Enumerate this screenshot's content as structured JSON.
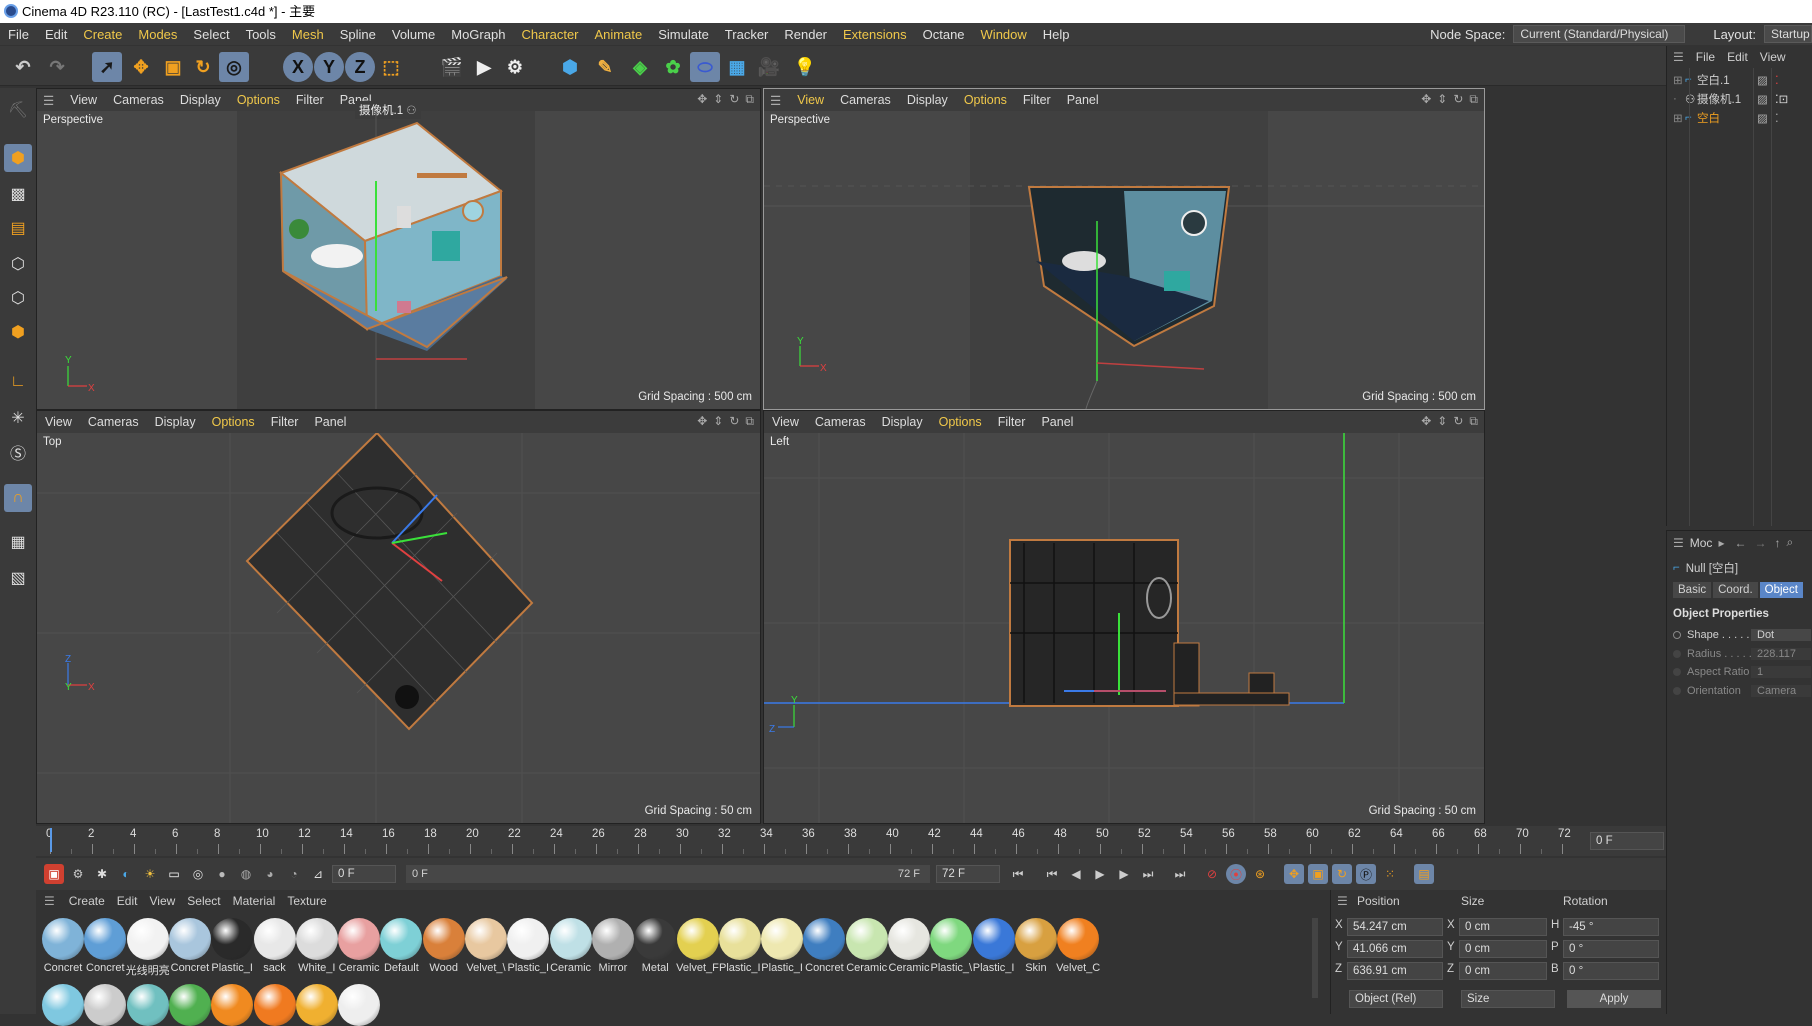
{
  "window": {
    "title": "Cinema 4D R23.110 (RC) - [LastTest1.c4d *] - 主要"
  },
  "menubar": {
    "items": [
      "File",
      "Edit",
      "Create",
      "Modes",
      "Select",
      "Tools",
      "Mesh",
      "Spline",
      "Volume",
      "MoGraph",
      "Character",
      "Animate",
      "Simulate",
      "Tracker",
      "Render",
      "Extensions",
      "Octane",
      "Window",
      "Help"
    ],
    "node_space_label": "Node Space:",
    "node_space_value": "Current (Standard/Physical)",
    "layout_label": "Layout:",
    "layout_value": "Startup ("
  },
  "toolbar": {
    "x_label": "X",
    "y_label": "Y",
    "z_label": "Z"
  },
  "viewports": [
    {
      "menu": [
        "View",
        "Cameras",
        "Display",
        "Options",
        "Filter",
        "Panel"
      ],
      "label": "Perspective",
      "camera_name": "摄像机.1",
      "grid_spacing": "Grid Spacing : 500 cm"
    },
    {
      "menu": [
        "View",
        "Cameras",
        "Display",
        "Options",
        "Filter",
        "Panel"
      ],
      "label": "Perspective",
      "grid_spacing": "Grid Spacing : 500 cm"
    },
    {
      "menu": [
        "View",
        "Cameras",
        "Display",
        "Options",
        "Filter",
        "Panel"
      ],
      "label": "Top",
      "grid_spacing": "Grid Spacing : 50 cm"
    },
    {
      "menu": [
        "View",
        "Cameras",
        "Display",
        "Options",
        "Filter",
        "Panel"
      ],
      "label": "Left",
      "grid_spacing": "Grid Spacing : 50 cm"
    }
  ],
  "object_manager": {
    "menu": [
      "File",
      "Edit",
      "View"
    ],
    "objects": [
      {
        "name": "空白.1",
        "selected": false
      },
      {
        "name": "摄像机.1",
        "selected": false
      },
      {
        "name": "空白",
        "selected": true
      }
    ]
  },
  "attribute_manager": {
    "mode_label": "Moc",
    "object_title": "Null [空白]",
    "tabs": [
      "Basic",
      "Coord.",
      "Object"
    ],
    "active_tab": "Object",
    "section_title": "Object Properties",
    "properties": [
      {
        "label": "Shape . . . . .",
        "value": "Dot"
      },
      {
        "label": "Radius . . . . .",
        "value": "228.117"
      },
      {
        "label": "Aspect Ratio",
        "value": "1"
      },
      {
        "label": "Orientation",
        "value": "Camera"
      }
    ]
  },
  "timeline": {
    "ticks": [
      "0",
      "2",
      "4",
      "6",
      "8",
      "10",
      "12",
      "14",
      "16",
      "18",
      "20",
      "22",
      "24",
      "26",
      "28",
      "30",
      "32",
      "34",
      "36",
      "38",
      "40",
      "42",
      "44",
      "46",
      "48",
      "50",
      "52",
      "54",
      "56",
      "58",
      "60",
      "62",
      "64",
      "66",
      "68",
      "70",
      "72"
    ],
    "current_frame": "0 F"
  },
  "playbar": {
    "start": "0 F",
    "range_start": "0 F",
    "range_end": "72 F",
    "end": "72 F"
  },
  "material_manager": {
    "menu": [
      "Create",
      "Edit",
      "View",
      "Select",
      "Material",
      "Texture"
    ],
    "materials": [
      {
        "name": "Concret",
        "color": "#7fb3d8"
      },
      {
        "name": "Concret",
        "color": "#5f9ed6"
      },
      {
        "name": "光线明亮",
        "color": "#f2f2f2"
      },
      {
        "name": "Concret",
        "color": "#a9c6dd"
      },
      {
        "name": "Plastic_I",
        "color": "#2a2a2a"
      },
      {
        "name": "sack",
        "color": "#e8e8e8"
      },
      {
        "name": "White_I",
        "color": "#dcdcdc"
      },
      {
        "name": "Ceramic",
        "color": "#e8a0a0"
      },
      {
        "name": "Default",
        "color": "#7ed0d6"
      },
      {
        "name": "Wood",
        "color": "#d9803a"
      },
      {
        "name": "Velvet_\\",
        "color": "#e8c8a0"
      },
      {
        "name": "Plastic_I",
        "color": "#f0f0f0"
      },
      {
        "name": "Ceramic",
        "color": "#bfe0e6"
      },
      {
        "name": "Mirror",
        "color": "#b0b0b0"
      },
      {
        "name": "Metal",
        "color": "#3a3a3a"
      },
      {
        "name": "Velvet_F",
        "color": "#e3d050"
      },
      {
        "name": "Plastic_I",
        "color": "#e8e09a"
      },
      {
        "name": "Plastic_I",
        "color": "#eee8b0"
      },
      {
        "name": "Concret",
        "color": "#3f7ec0"
      },
      {
        "name": "Ceramic",
        "color": "#c8e6b0"
      },
      {
        "name": "Ceramic",
        "color": "#e6e6e0"
      },
      {
        "name": "Plastic_\\",
        "color": "#7fd87f"
      },
      {
        "name": "Plastic_I",
        "color": "#3a78d8"
      },
      {
        "name": "Skin",
        "color": "#d8a040"
      },
      {
        "name": "Velvet_C",
        "color": "#f08020"
      }
    ],
    "second_row": [
      "#7fc8e0",
      "#cccccc",
      "#70c0c0",
      "#50b050",
      "#f08a20",
      "#f07a20",
      "#f0b030",
      "#eeeeee"
    ]
  },
  "coordinates": {
    "headers": [
      "Position",
      "Size",
      "Rotation"
    ],
    "rows": [
      {
        "axis": "X",
        "pos": "54.247 cm",
        "size_axis": "X",
        "size": "0 cm",
        "rot_axis": "H",
        "rot": "-45 °"
      },
      {
        "axis": "Y",
        "pos": "41.066 cm",
        "size_axis": "Y",
        "size": "0 cm",
        "rot_axis": "P",
        "rot": "0 °"
      },
      {
        "axis": "Z",
        "pos": "636.91 cm",
        "size_axis": "Z",
        "size": "0 cm",
        "rot_axis": "B",
        "rot": "0 °"
      }
    ],
    "mode": "Object (Rel)",
    "size_mode": "Size",
    "apply": "Apply"
  }
}
